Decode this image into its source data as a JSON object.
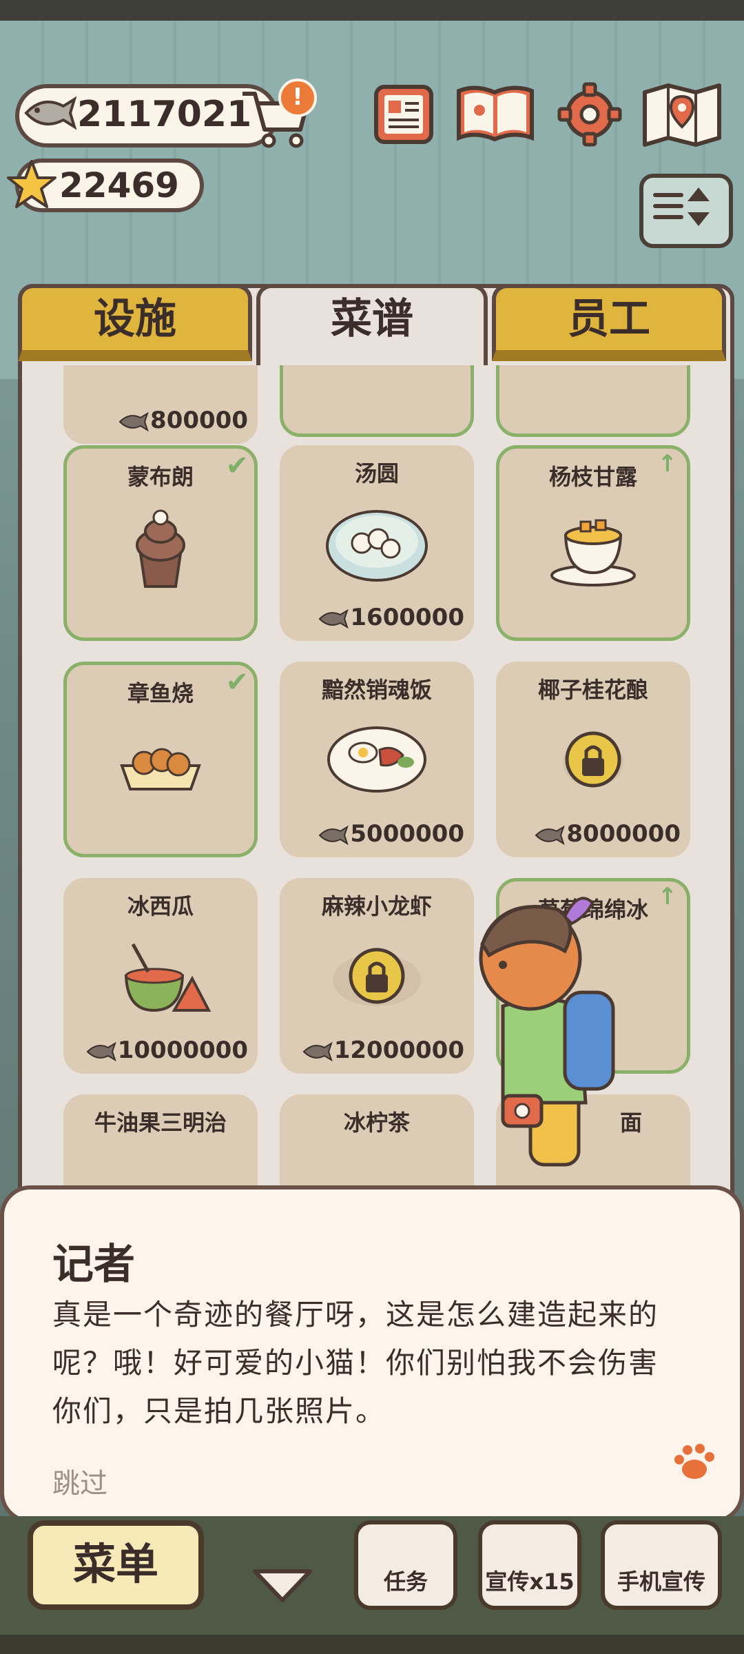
{
  "currency": {
    "fish": "2117021",
    "stars": "22469"
  },
  "tabs": [
    {
      "label": "设施",
      "active": false
    },
    {
      "label": "菜谱",
      "active": true
    },
    {
      "label": "员工",
      "active": false
    }
  ],
  "recipes": {
    "partial_row": [
      {
        "price": "800000"
      }
    ],
    "cards": [
      {
        "name": "蒙布朗",
        "price": "",
        "status": "owned"
      },
      {
        "name": "汤圆",
        "price": "1600000",
        "status": "available"
      },
      {
        "name": "杨枝甘露",
        "price": "",
        "status": "upgrade"
      },
      {
        "name": "章鱼烧",
        "price": "",
        "status": "owned"
      },
      {
        "name": "黯然销魂饭",
        "price": "5000000",
        "status": "available"
      },
      {
        "name": "椰子桂花酿",
        "price": "8000000",
        "status": "locked"
      },
      {
        "name": "冰西瓜",
        "price": "10000000",
        "status": "available"
      },
      {
        "name": "麻辣小龙虾",
        "price": "12000000",
        "status": "locked"
      },
      {
        "name": "草莓绵绵冰",
        "price": "",
        "status": "upgrade"
      },
      {
        "name": "牛油果三明治",
        "price": "",
        "status": "available"
      },
      {
        "name": "冰柠茶",
        "price": "",
        "status": "available"
      },
      {
        "name": "面",
        "price": "",
        "status": "available"
      }
    ]
  },
  "dialog": {
    "speaker": "记者",
    "lines": [
      "真是一个奇迹的餐厅呀，这是怎么建造起来的",
      "呢？哦！好可爱的小猫！你们别怕我不会伤害",
      "你们，只是拍几张照片。"
    ],
    "skip": "跳过"
  },
  "bottom_bar": {
    "menu_label": "菜单",
    "buttons": [
      "任务",
      "宣传x15",
      "手机宣传"
    ]
  },
  "colors": {
    "tab_active": "#e9e2dc",
    "tab_inactive": "#e0b53e",
    "card": "#dcccb6",
    "owned_border": "#8bb06a"
  }
}
